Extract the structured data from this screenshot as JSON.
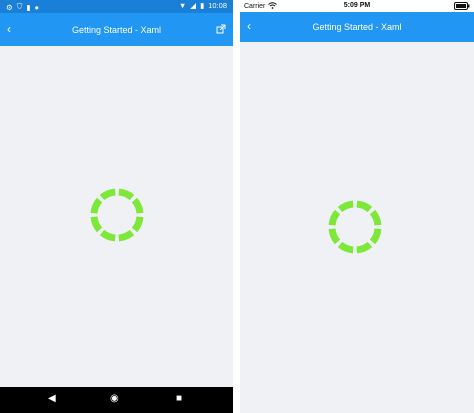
{
  "android": {
    "status_time": "10:08",
    "title": "Getting Started - Xaml",
    "icons": {
      "status_left": [
        "gear-icon",
        "shield-icon",
        "sim-icon",
        "circle-icon"
      ],
      "status_right": [
        "wifi-icon",
        "signal-icon",
        "battery-icon"
      ],
      "back": "chevron-left-icon",
      "external": "external-link-icon",
      "nav": [
        "back-triangle-icon",
        "home-circle-icon",
        "overview-square-icon"
      ]
    }
  },
  "ios": {
    "carrier": "Carrier",
    "status_time": "5:09 PM",
    "title": "Getting Started - Xaml",
    "icons": {
      "back": "chevron-left-icon",
      "wifi": "wifi-icon",
      "battery": "battery-icon"
    }
  },
  "spinner": {
    "color": "#7ee83a",
    "segments": 8
  },
  "colors": {
    "accent": "#2196f3",
    "android_status": "#1a7fd6",
    "content_bg": "#f0f1f4"
  }
}
